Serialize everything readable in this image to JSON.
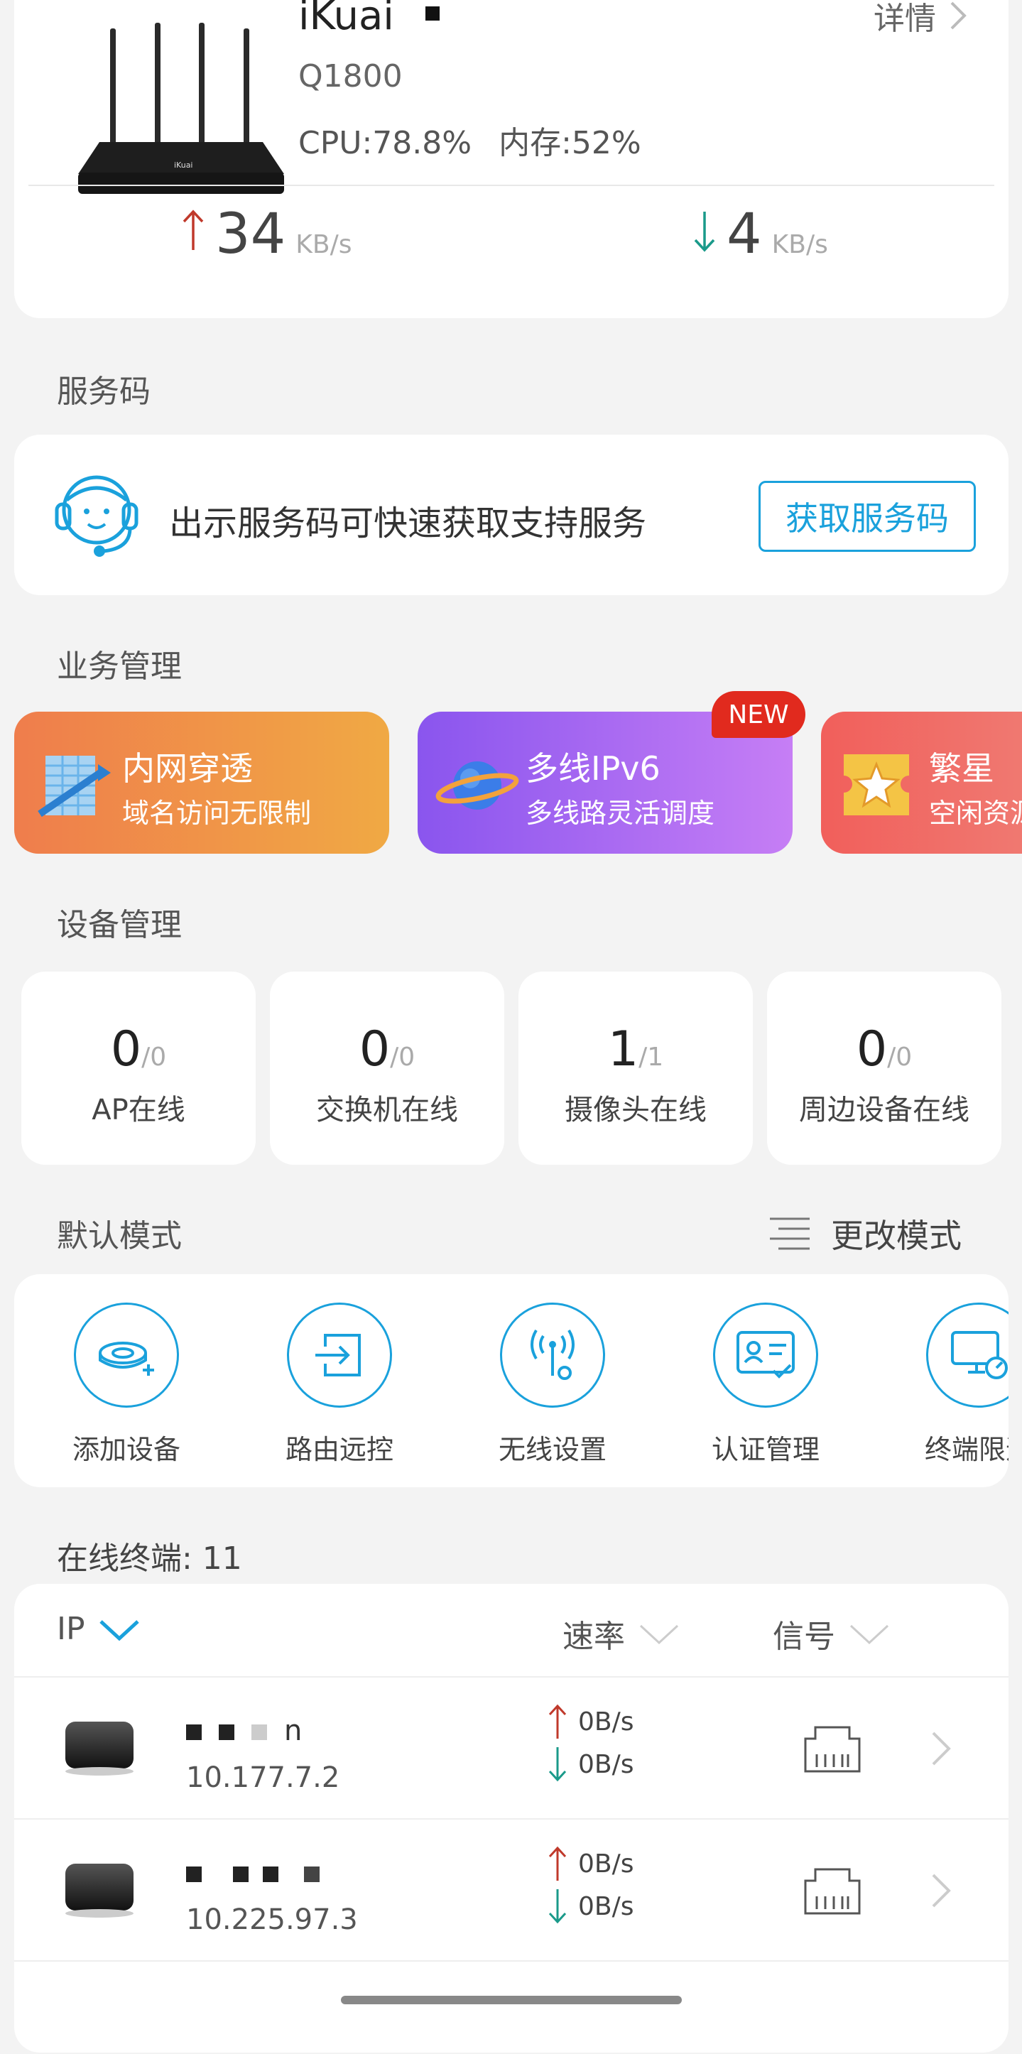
{
  "router": {
    "name": "iKuai",
    "model": "Q1800",
    "cpu_label": "CPU:",
    "cpu_value": "78.8%",
    "mem_label": "内存:",
    "mem_value": "52%",
    "detail_label": "详情",
    "upload_value": "34",
    "upload_unit": "KB/s",
    "download_value": "4",
    "download_unit": "KB/s"
  },
  "service": {
    "section_title": "服务码",
    "description": "出示服务码可快速获取支持服务",
    "button_label": "获取服务码"
  },
  "business": {
    "section_title": "业务管理",
    "cards": [
      {
        "title": "内网穿透",
        "subtitle": "域名访问无限制"
      },
      {
        "title": "多线IPv6",
        "subtitle": "多线路灵活调度",
        "badge": "NEW"
      },
      {
        "title": "繁星",
        "subtitle": "空闲资源"
      }
    ]
  },
  "devices": {
    "section_title": "设备管理",
    "items": [
      {
        "count": "0",
        "total": "/0",
        "label": "AP在线"
      },
      {
        "count": "0",
        "total": "/0",
        "label": "交换机在线"
      },
      {
        "count": "1",
        "total": "/1",
        "label": "摄像头在线"
      },
      {
        "count": "0",
        "total": "/0",
        "label": "周边设备在线"
      }
    ]
  },
  "mode": {
    "section_title": "默认模式",
    "change_label": "更改模式",
    "tools": [
      {
        "label": "添加设备",
        "icon": "add-device-icon"
      },
      {
        "label": "路由远控",
        "icon": "remote-control-icon"
      },
      {
        "label": "无线设置",
        "icon": "wireless-settings-icon"
      },
      {
        "label": "认证管理",
        "icon": "auth-management-icon"
      },
      {
        "label": "终端限速",
        "icon": "terminal-speed-limit-icon"
      }
    ]
  },
  "terminals": {
    "section_title": "在线终端: 11",
    "headers": {
      "ip": "IP",
      "rate": "速率",
      "signal": "信号"
    },
    "rows": [
      {
        "name": "n",
        "ip": "10.177.7.2",
        "up": "0B/s",
        "down": "0B/s"
      },
      {
        "name": "",
        "ip": "10.225.97.3",
        "up": "0B/s",
        "down": "0B/s"
      }
    ]
  },
  "colors": {
    "accent": "#1aa1dc",
    "up_arrow": "#c0392b",
    "down_arrow": "#1a9a8a",
    "badge": "#e12a1e"
  }
}
